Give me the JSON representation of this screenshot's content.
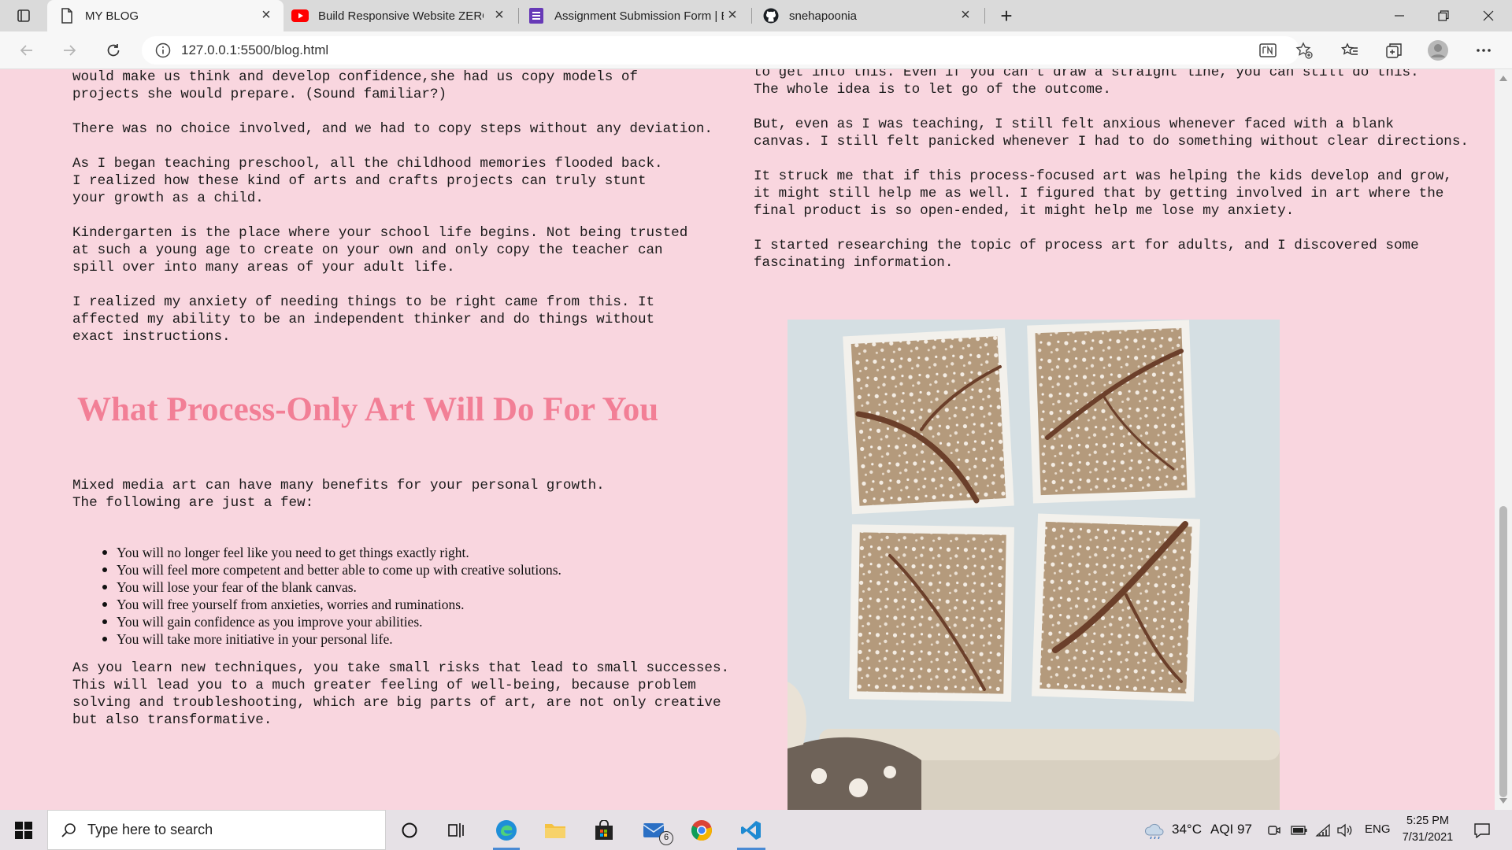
{
  "browser": {
    "tabs": [
      {
        "title": "MY BLOG",
        "icon": "document-icon",
        "active": true
      },
      {
        "title": "Build Responsive Website ZERO T",
        "icon": "youtube-icon",
        "active": false
      },
      {
        "title": "Assignment Submission Form | E",
        "icon": "forms-icon",
        "active": false
      },
      {
        "title": "snehapoonia",
        "icon": "github-icon",
        "active": false
      }
    ],
    "url": "127.0.0.1:5500/blog.html"
  },
  "article": {
    "left_paragraphs": [
      "would make us think and develop confidence,she had us copy models of\nprojects she would prepare. (Sound familiar?)",
      "There was no choice involved, and we had to copy steps without any deviation.",
      "As I began teaching preschool, all the childhood memories flooded back.\nI realized how these kind of arts and crafts projects can truly stunt\nyour growth as a child.",
      "Kindergarten is the place where your school life begins. Not being trusted\nat such a young age to create on your own and only copy the teacher can\nspill over into many areas of your adult life.",
      "I realized my anxiety of needing things to be right came from this. It\naffected my ability to be an independent thinker and do things without\nexact instructions."
    ],
    "heading": "What Process-Only Art Will Do For You",
    "intro": "Mixed media art can have many benefits for your personal growth.\nThe following are just a few:",
    "benefits": [
      "You will no longer feel like you need to get things exactly right.",
      "You will feel more competent and better able to come up with creative solutions.",
      "You will lose your fear of the blank canvas.",
      "You will free yourself from anxieties, worries and ruminations.",
      "You will gain confidence as you improve your abilities.",
      "You will take more initiative in your personal life."
    ],
    "closing": "As you learn new techniques, you take small risks that lead to small successes.\nThis will lead you to a much greater feeling of well-being, because problem\nsolving and troubleshooting, which are big parts of art, are not only creative\nbut also transformative.",
    "right_paragraphs": [
      "to get into this. Even if you can't draw a straight line, you can still do this.\nThe whole idea is to let go of the outcome.",
      "But, even as I was teaching, I still felt anxious whenever faced with a blank\ncanvas. I still felt panicked whenever I had to do something without clear directions.",
      "It struck me that if this process-focused art was helping the kids develop and grow,\nit might still help me as well. I figured that by getting involved in art where the\nfinal product is so open-ended, it might help me lose my anxiety.",
      "I started researching the topic of process art for adults, and I discovered some\nfascinating information."
    ]
  },
  "taskbar": {
    "search_placeholder": "Type here to search",
    "mail_badge": "6",
    "weather": "34°C",
    "aqi": "AQI 97",
    "language": "ENG",
    "time": "5:25 PM",
    "date": "7/31/2021"
  },
  "colors": {
    "page_background": "#f9d6df",
    "heading": "#f27f96"
  }
}
